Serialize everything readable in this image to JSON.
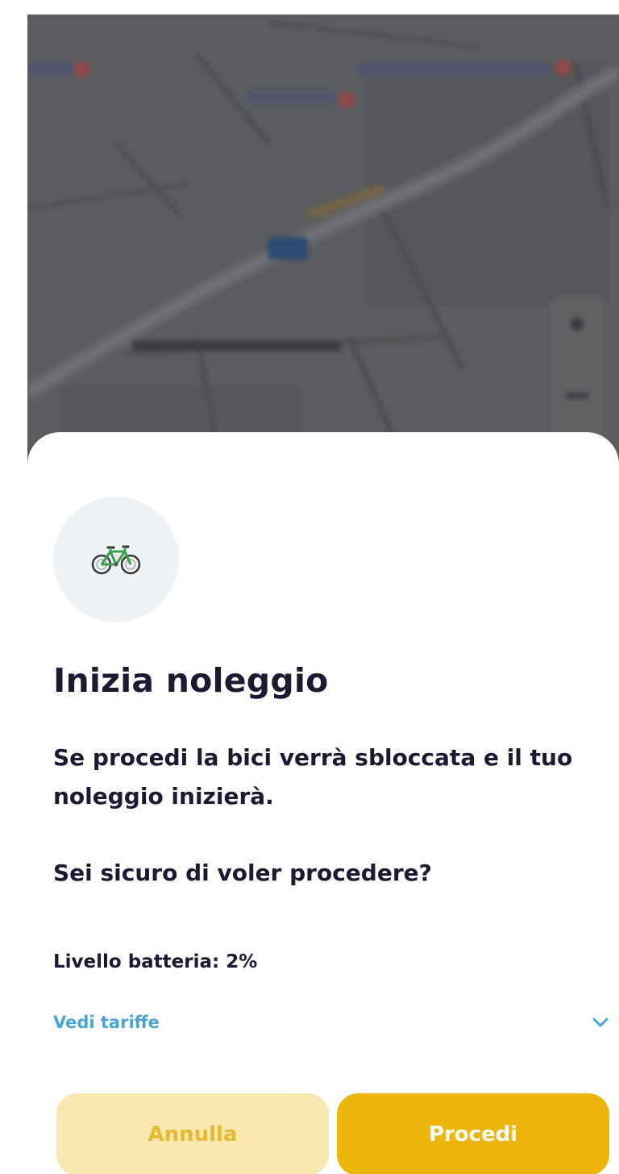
{
  "map": {
    "blurred_labels": [
      "",
      "",
      ""
    ]
  },
  "dialog": {
    "icon": "bicycle-icon",
    "title": "Inizia noleggio",
    "message": "Se procedi la bici verrà sbloccata e il tuo noleggio inizierà.",
    "question": "Sei sicuro di voler procedere?",
    "battery": "Livello batteria: 2%",
    "rates_link": "Vedi tariffe",
    "rates_chevron_icon": "chevron-down-icon",
    "cancel_label": "Annulla",
    "proceed_label": "Procedi"
  },
  "colors": {
    "primary": "#ecb60b",
    "primary_light": "#f8e7ae",
    "link": "#47a6d8",
    "text": "#1b1a33",
    "icon_bg": "#eff2f5"
  }
}
